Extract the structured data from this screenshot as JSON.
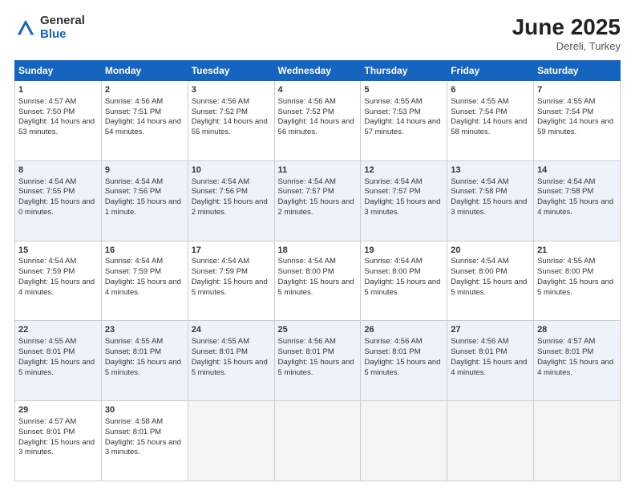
{
  "logo": {
    "general": "General",
    "blue": "Blue"
  },
  "title": "June 2025",
  "location": "Dereli, Turkey",
  "days": [
    "Sunday",
    "Monday",
    "Tuesday",
    "Wednesday",
    "Thursday",
    "Friday",
    "Saturday"
  ],
  "weeks": [
    [
      {
        "day": 1,
        "sunrise": "4:57 AM",
        "sunset": "7:50 PM",
        "daylight": "14 hours and 53 minutes."
      },
      {
        "day": 2,
        "sunrise": "4:56 AM",
        "sunset": "7:51 PM",
        "daylight": "14 hours and 54 minutes."
      },
      {
        "day": 3,
        "sunrise": "4:56 AM",
        "sunset": "7:52 PM",
        "daylight": "14 hours and 55 minutes."
      },
      {
        "day": 4,
        "sunrise": "4:56 AM",
        "sunset": "7:52 PM",
        "daylight": "14 hours and 56 minutes."
      },
      {
        "day": 5,
        "sunrise": "4:55 AM",
        "sunset": "7:53 PM",
        "daylight": "14 hours and 57 minutes."
      },
      {
        "day": 6,
        "sunrise": "4:55 AM",
        "sunset": "7:54 PM",
        "daylight": "14 hours and 58 minutes."
      },
      {
        "day": 7,
        "sunrise": "4:55 AM",
        "sunset": "7:54 PM",
        "daylight": "14 hours and 59 minutes."
      }
    ],
    [
      {
        "day": 8,
        "sunrise": "4:54 AM",
        "sunset": "7:55 PM",
        "daylight": "15 hours and 0 minutes."
      },
      {
        "day": 9,
        "sunrise": "4:54 AM",
        "sunset": "7:56 PM",
        "daylight": "15 hours and 1 minute."
      },
      {
        "day": 10,
        "sunrise": "4:54 AM",
        "sunset": "7:56 PM",
        "daylight": "15 hours and 2 minutes."
      },
      {
        "day": 11,
        "sunrise": "4:54 AM",
        "sunset": "7:57 PM",
        "daylight": "15 hours and 2 minutes."
      },
      {
        "day": 12,
        "sunrise": "4:54 AM",
        "sunset": "7:57 PM",
        "daylight": "15 hours and 3 minutes."
      },
      {
        "day": 13,
        "sunrise": "4:54 AM",
        "sunset": "7:58 PM",
        "daylight": "15 hours and 3 minutes."
      },
      {
        "day": 14,
        "sunrise": "4:54 AM",
        "sunset": "7:58 PM",
        "daylight": "15 hours and 4 minutes."
      }
    ],
    [
      {
        "day": 15,
        "sunrise": "4:54 AM",
        "sunset": "7:59 PM",
        "daylight": "15 hours and 4 minutes."
      },
      {
        "day": 16,
        "sunrise": "4:54 AM",
        "sunset": "7:59 PM",
        "daylight": "15 hours and 4 minutes."
      },
      {
        "day": 17,
        "sunrise": "4:54 AM",
        "sunset": "7:59 PM",
        "daylight": "15 hours and 5 minutes."
      },
      {
        "day": 18,
        "sunrise": "4:54 AM",
        "sunset": "8:00 PM",
        "daylight": "15 hours and 5 minutes."
      },
      {
        "day": 19,
        "sunrise": "4:54 AM",
        "sunset": "8:00 PM",
        "daylight": "15 hours and 5 minutes."
      },
      {
        "day": 20,
        "sunrise": "4:54 AM",
        "sunset": "8:00 PM",
        "daylight": "15 hours and 5 minutes."
      },
      {
        "day": 21,
        "sunrise": "4:55 AM",
        "sunset": "8:00 PM",
        "daylight": "15 hours and 5 minutes."
      }
    ],
    [
      {
        "day": 22,
        "sunrise": "4:55 AM",
        "sunset": "8:01 PM",
        "daylight": "15 hours and 5 minutes."
      },
      {
        "day": 23,
        "sunrise": "4:55 AM",
        "sunset": "8:01 PM",
        "daylight": "15 hours and 5 minutes."
      },
      {
        "day": 24,
        "sunrise": "4:55 AM",
        "sunset": "8:01 PM",
        "daylight": "15 hours and 5 minutes."
      },
      {
        "day": 25,
        "sunrise": "4:56 AM",
        "sunset": "8:01 PM",
        "daylight": "15 hours and 5 minutes."
      },
      {
        "day": 26,
        "sunrise": "4:56 AM",
        "sunset": "8:01 PM",
        "daylight": "15 hours and 5 minutes."
      },
      {
        "day": 27,
        "sunrise": "4:56 AM",
        "sunset": "8:01 PM",
        "daylight": "15 hours and 4 minutes."
      },
      {
        "day": 28,
        "sunrise": "4:57 AM",
        "sunset": "8:01 PM",
        "daylight": "15 hours and 4 minutes."
      }
    ],
    [
      {
        "day": 29,
        "sunrise": "4:57 AM",
        "sunset": "8:01 PM",
        "daylight": "15 hours and 3 minutes."
      },
      {
        "day": 30,
        "sunrise": "4:58 AM",
        "sunset": "8:01 PM",
        "daylight": "15 hours and 3 minutes."
      },
      null,
      null,
      null,
      null,
      null
    ]
  ]
}
